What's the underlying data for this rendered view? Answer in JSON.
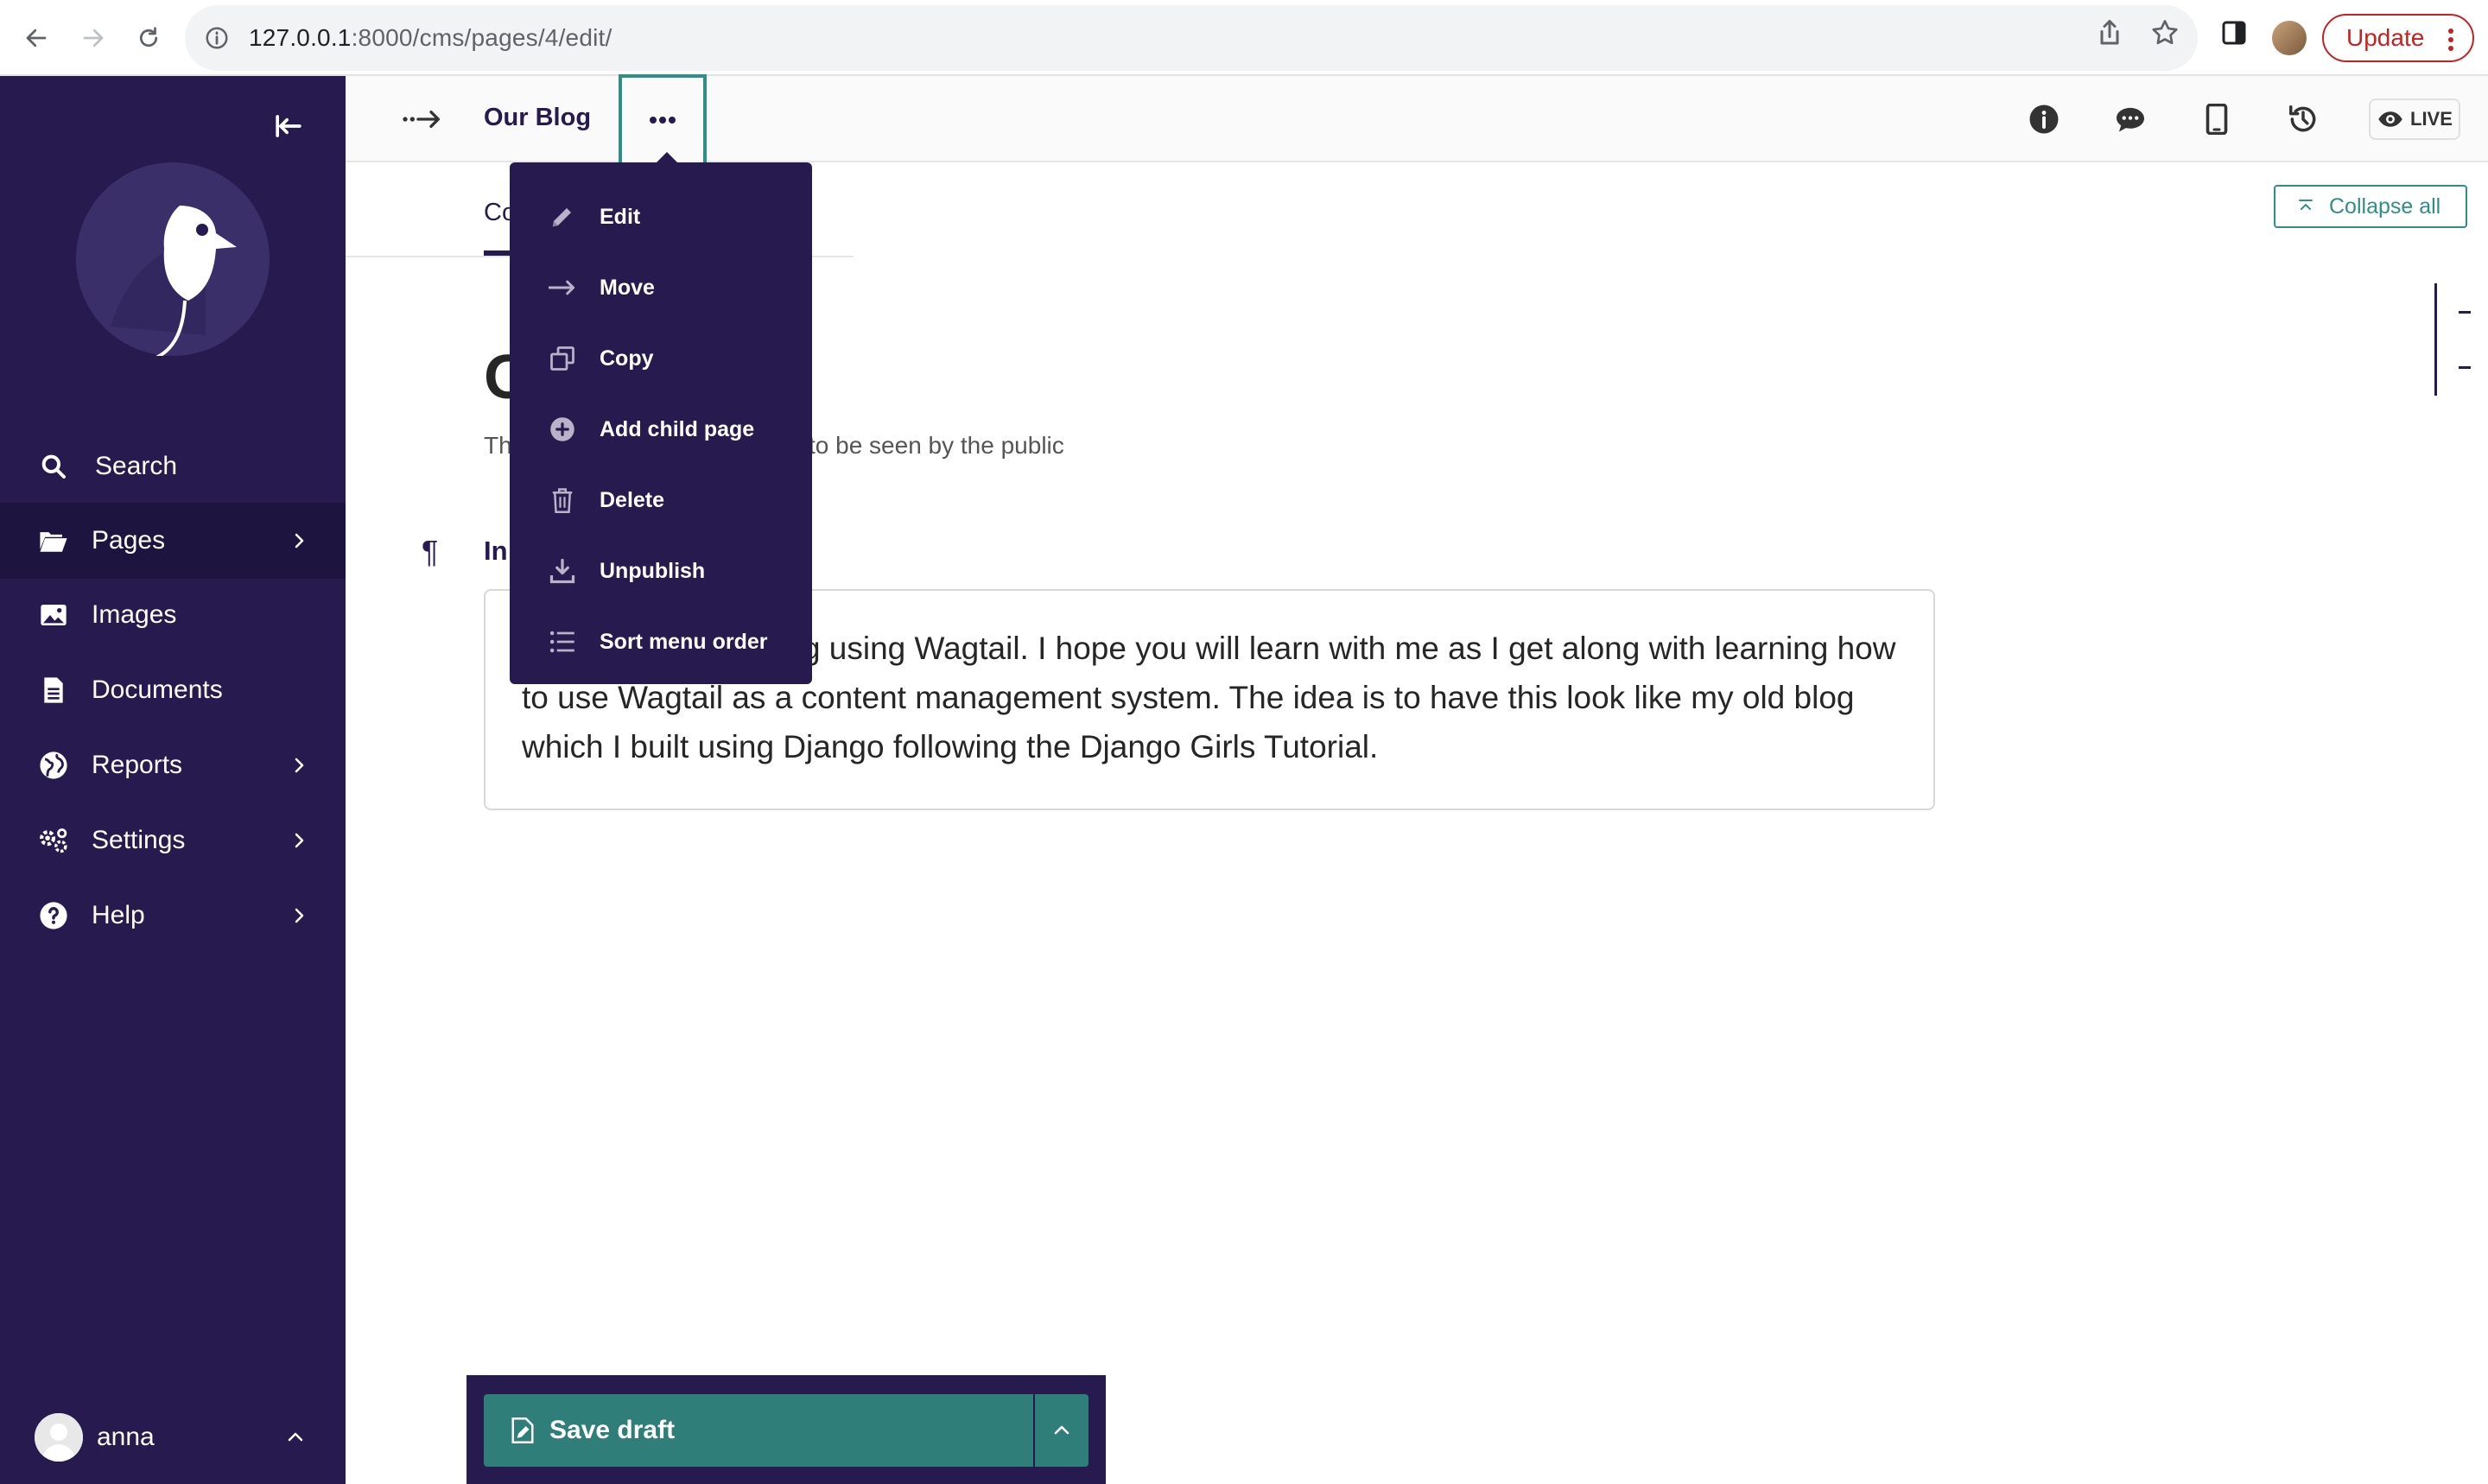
{
  "browser": {
    "url_host": "127.0.0.1",
    "url_path": ":8000/cms/pages/4/edit/",
    "update_label": "Update"
  },
  "sidebar": {
    "items": [
      {
        "label": "Search",
        "icon": "search-icon"
      },
      {
        "label": "Pages",
        "icon": "folder-open-icon"
      },
      {
        "label": "Images",
        "icon": "image-icon"
      },
      {
        "label": "Documents",
        "icon": "document-icon"
      },
      {
        "label": "Reports",
        "icon": "globe-icon"
      },
      {
        "label": "Settings",
        "icon": "cogs-icon"
      },
      {
        "label": "Help",
        "icon": "help-icon"
      }
    ],
    "account_name": "anna"
  },
  "header": {
    "title": "Our Blog",
    "live_label": "LIVE"
  },
  "tabs": {
    "content_fragment": "Co"
  },
  "actions_menu": {
    "items": [
      {
        "label": "Edit",
        "icon": "pencil-icon"
      },
      {
        "label": "Move",
        "icon": "arrow-right-icon"
      },
      {
        "label": "Copy",
        "icon": "copy-icon"
      },
      {
        "label": "Add child page",
        "icon": "plus-circle-icon"
      },
      {
        "label": "Delete",
        "icon": "bin-icon"
      },
      {
        "label": "Unpublish",
        "icon": "download-icon"
      },
      {
        "label": "Sort menu order",
        "icon": "list-icon"
      }
    ]
  },
  "main": {
    "collapse_all_label": "Collapse all",
    "heading_fragment": "O",
    "help_fragment": "Th",
    "help_tail": "to be seen by the public",
    "intro_label_fragment": "In",
    "intro_text": "g which I am building using Wagtail. I hope you will learn with me as I get along with learning how to use Wagtail as a content management system. The idea is to have this look like my old blog which I built using Django following the Django Girls Tutorial."
  },
  "footer": {
    "save_draft_label": "Save draft"
  },
  "colors": {
    "sidebar_bg": "#261a4e",
    "accent_teal": "#2f7e7a"
  }
}
